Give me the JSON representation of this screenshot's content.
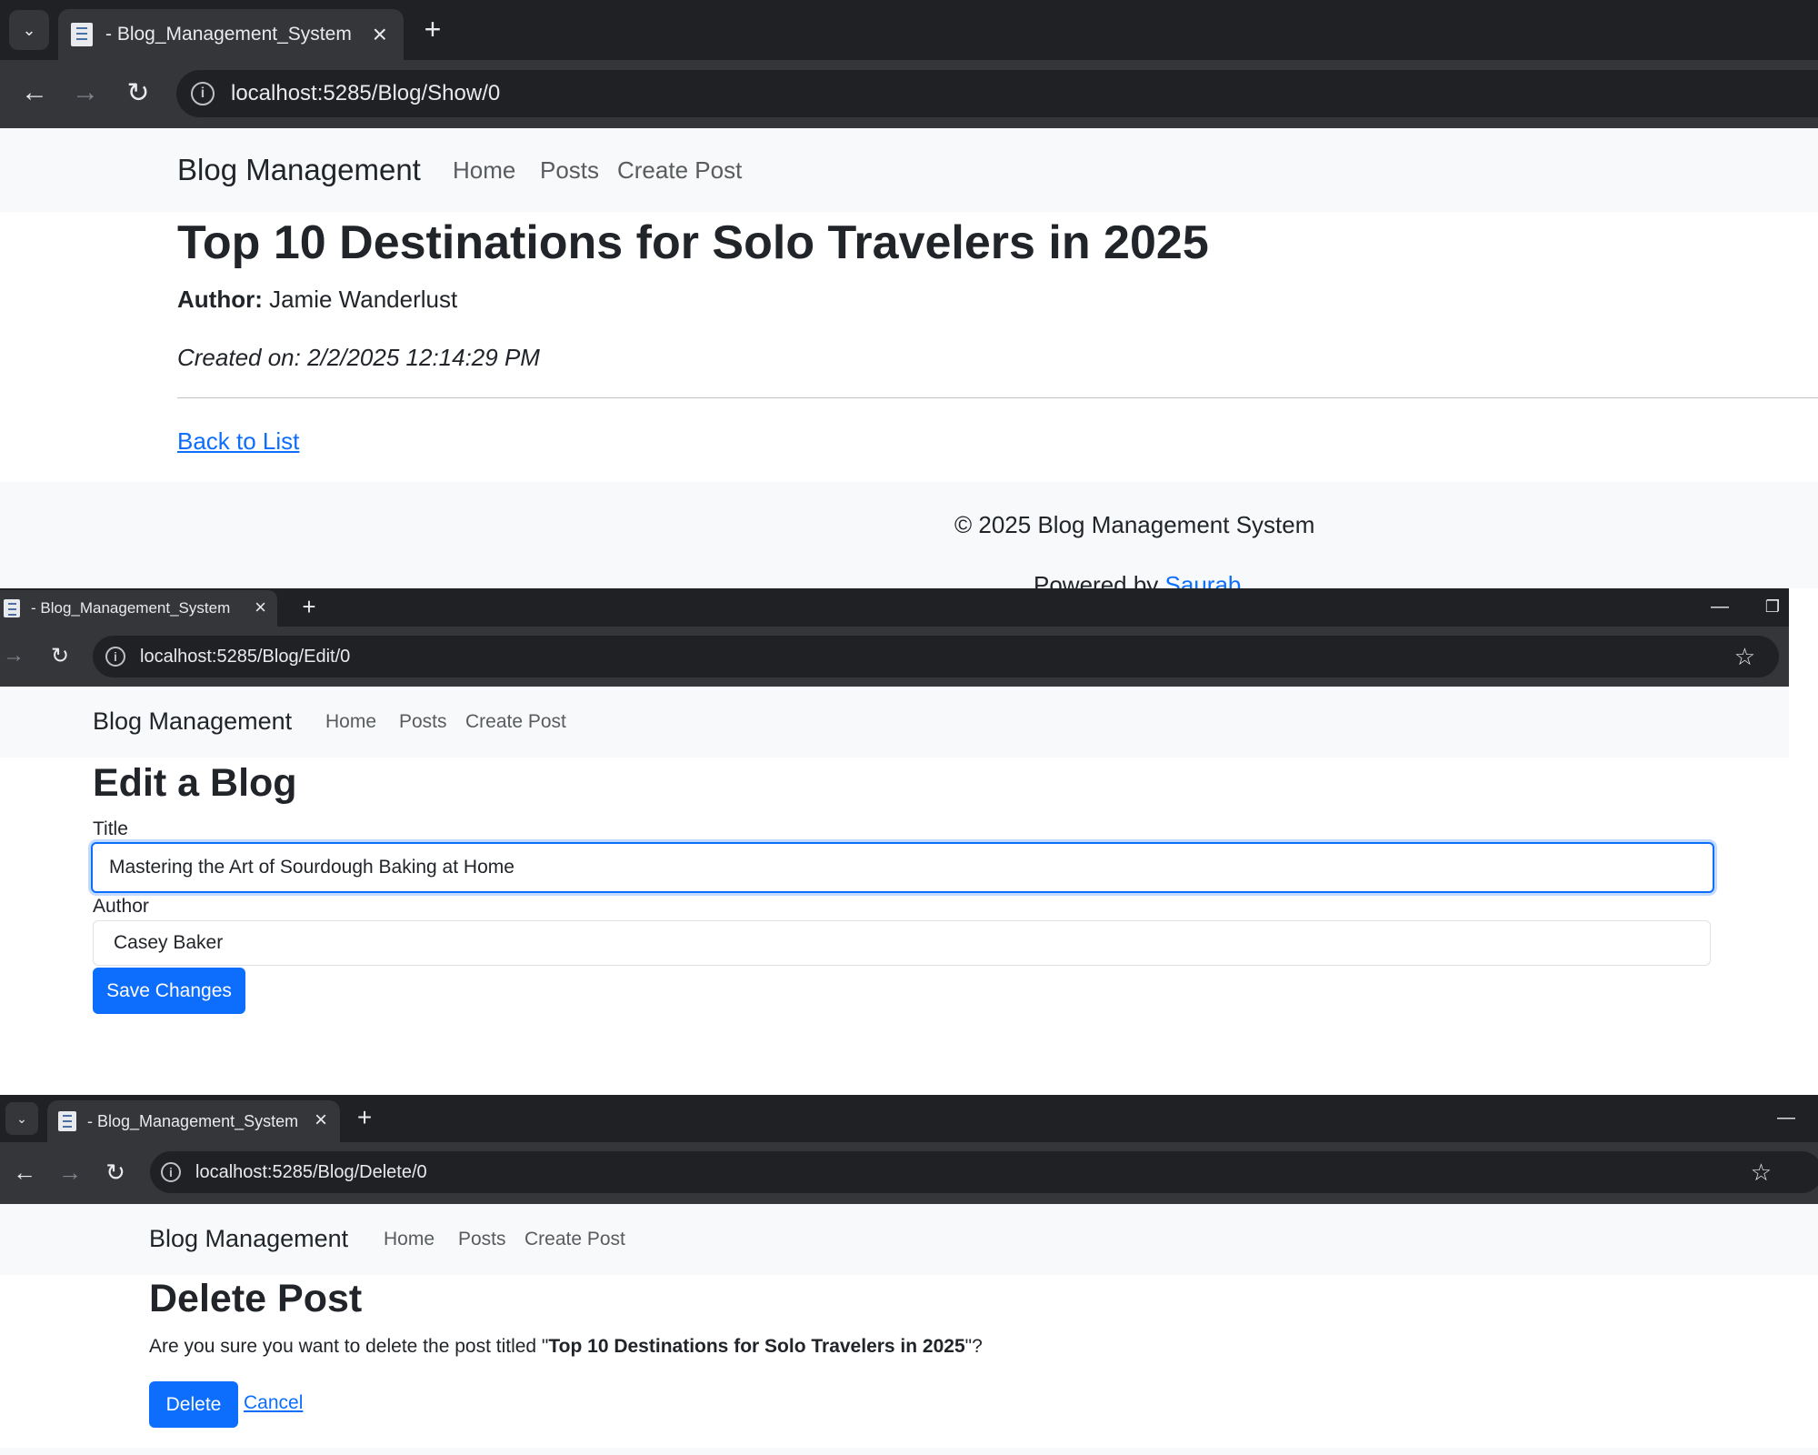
{
  "browser": {
    "tab_title": "- Blog_Management_System",
    "new_tab_symbol": "+",
    "close_symbol": "×"
  },
  "colors": {
    "primary": "#0d6efd",
    "navbar_bg": "#f8f9fa",
    "chrome_dark": "#202124",
    "chrome_toolbar": "#35363a"
  },
  "nav": {
    "brand": "Blog Management",
    "home": "Home",
    "posts": "Posts",
    "create_post": "Create Post"
  },
  "show_page": {
    "url": "localhost:5285/Blog/Show/0",
    "title": "Top 10 Destinations for Solo Travelers in 2025",
    "author_label": "Author:",
    "author_value": "Jamie Wanderlust",
    "created_on": "Created on: 2/2/2025 12:14:29 PM",
    "back_link": "Back to List",
    "footer_copyright": "© 2025 Blog Management System",
    "footer_powered_prefix": "Powered by",
    "footer_powered_link": "Saurab"
  },
  "edit_page": {
    "url": "localhost:5285/Blog/Edit/0",
    "heading": "Edit a Blog",
    "title_label": "Title",
    "title_value": "Mastering the Art of Sourdough Baking at Home",
    "author_label": "Author",
    "author_value": "Casey Baker",
    "save_button": "Save Changes"
  },
  "delete_page": {
    "url": "localhost:5285/Blog/Delete/0",
    "heading": "Delete Post",
    "confirm_prefix": "Are you sure you want to delete the post titled \"",
    "confirm_post_title": "Top 10 Destinations for Solo Travelers in 2025",
    "confirm_suffix": "\"?",
    "delete_button": "Delete",
    "cancel_link": "Cancel"
  }
}
